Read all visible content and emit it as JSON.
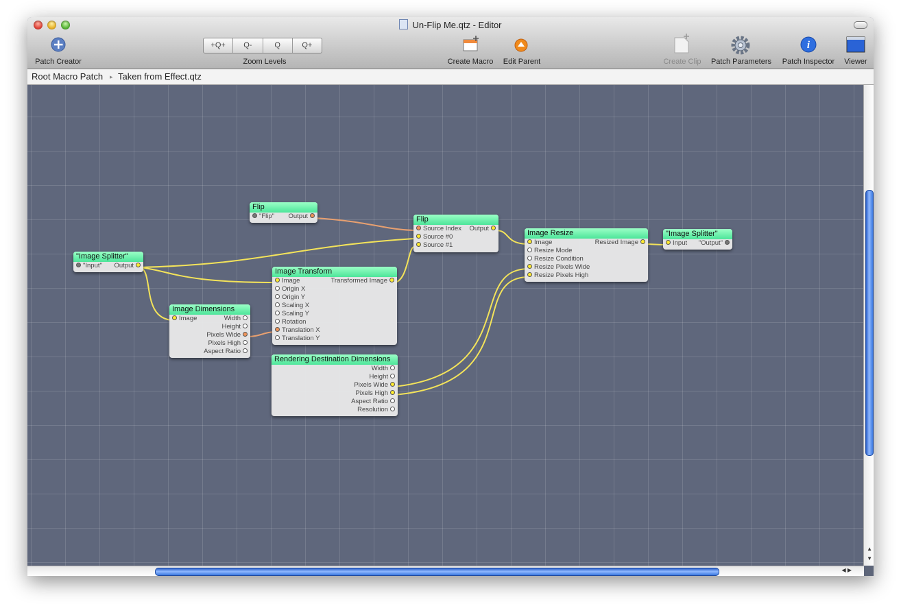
{
  "window": {
    "title": "Un-Flip Me.qtz - Editor"
  },
  "toolbar": {
    "patch_creator": "Patch Creator",
    "zoom_levels": "Zoom Levels",
    "zoom_buttons": [
      "+Q+",
      "Q-",
      "Q",
      "Q+"
    ],
    "create_macro": "Create Macro",
    "edit_parent": "Edit Parent",
    "create_clip": "Create Clip",
    "patch_parameters": "Patch Parameters",
    "patch_inspector": "Patch Inspector",
    "viewer": "Viewer"
  },
  "breadcrumb": {
    "root": "Root Macro Patch",
    "current": "Taken from Effect.qtz"
  },
  "patches": {
    "flip_input": {
      "title": "Flip",
      "in_label": "\"Flip\"",
      "out_label": "Output"
    },
    "flip": {
      "title": "Flip",
      "source_index": "Source Index",
      "output": "Output",
      "source0": "Source #0",
      "source1": "Source #1"
    },
    "splitter_input": {
      "title": "\"Image Splitter\"",
      "in_label": "\"Input\"",
      "out_label": "Output"
    },
    "image_transform": {
      "title": "Image Transform",
      "inputs": [
        "Image",
        "Origin X",
        "Origin Y",
        "Scaling X",
        "Scaling Y",
        "Rotation",
        "Translation X",
        "Translation Y"
      ],
      "output": "Transformed Image"
    },
    "image_dimensions": {
      "title": "Image Dimensions",
      "input": "Image",
      "outputs": [
        "Width",
        "Height",
        "Pixels Wide",
        "Pixels High",
        "Aspect Ratio"
      ]
    },
    "rendering_dest": {
      "title": "Rendering Destination Dimensions",
      "outputs": [
        "Width",
        "Height",
        "Pixels Wide",
        "Pixels High",
        "Aspect Ratio",
        "Resolution"
      ]
    },
    "image_resize": {
      "title": "Image Resize",
      "inputs": [
        "Image",
        "Resize Mode",
        "Resize Condition",
        "Resize Pixels Wide",
        "Resize Pixels High"
      ],
      "output": "Resized Image"
    },
    "splitter_output": {
      "title": "\"Image Splitter\"",
      "in_label": "Input",
      "out_label": "\"Output\""
    }
  },
  "colors": {
    "canvas": "#5f677c",
    "patch_header": "#4de59a",
    "cable_yellow": "#f3e35a",
    "cable_orange": "#e8a070"
  }
}
